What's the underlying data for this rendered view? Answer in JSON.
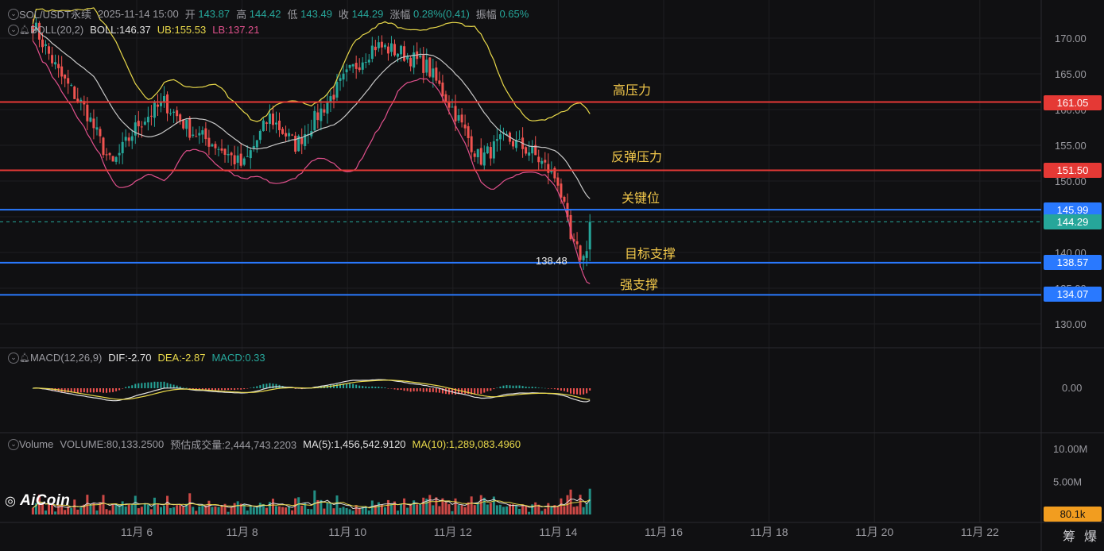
{
  "header": {
    "symbol": "SOL/USDT永续",
    "datetime": "2025-11-14 15:00",
    "open_label": "开",
    "open": "143.87",
    "high_label": "高",
    "high": "144.42",
    "low_label": "低",
    "low": "143.49",
    "close_label": "收",
    "close": "144.29",
    "change_label": "涨幅",
    "change": "0.28%(0.41)",
    "amp_label": "振幅",
    "amp": "0.65%"
  },
  "boll_legend": {
    "name": "BOLL(20,2)",
    "mid": "BOLL:146.37",
    "ub": "UB:155.53",
    "lb": "LB:137.21"
  },
  "macd_legend": {
    "name": "MACD(12,26,9)",
    "dif": "DIF:-2.70",
    "dea": "DEA:-2.87",
    "macd": "MACD:0.33"
  },
  "volume_legend": {
    "name": "Volume",
    "volume": "VOLUME:80,133.2500",
    "est": "预估成交量:2,444,743.2203",
    "ma5": "MA(5):1,456,542.9120",
    "ma10": "MA(10):1,289,083.4960"
  },
  "annotations": {
    "high_pressure": "高压力",
    "rebound_pressure": "反弹压力",
    "key_level": "关键位",
    "target_support": "目标支撑",
    "strong_support": "强支撑",
    "low_marker": "138.48"
  },
  "price_labels": {
    "r1": "161.05",
    "r2": "151.50",
    "key": "145.99",
    "current": "144.29",
    "s1": "138.57",
    "s2": "134.07",
    "volume_current": "80.1k"
  },
  "logo": "AiCoin",
  "corner_buttons": [
    "筹",
    "爆"
  ],
  "colors": {
    "up": "#26a69a",
    "down": "#ef5350",
    "resistance": "#e53935",
    "support": "#2979ff",
    "current_price": "#26a69a",
    "boll_mid": "#c8c8c8",
    "boll_ub": "#e8d84a",
    "boll_lb": "#e0508c",
    "dif": "#e0e0e0",
    "dea": "#e8d84a",
    "annotation": "#f0c64a",
    "volume_label": "#f29d1f"
  },
  "chart_data": [
    {
      "type": "line",
      "title": "SOL/USDT永续",
      "description": "Candlestick price chart with Bollinger Bands (20,2), hourly candles",
      "y_axis": {
        "ticks": [
          "130.00",
          "135.00",
          "140.00",
          "145.00",
          "150.00",
          "155.00",
          "160.00",
          "165.00",
          "170.00"
        ],
        "ylim": [
          127.4,
          174.0
        ]
      },
      "x_axis": {
        "ticks": [
          "11月 6",
          "11月 8",
          "11月 10",
          "11月 12",
          "11月 14",
          "11月 16",
          "11月 18",
          "11月 20",
          "11月 22"
        ]
      },
      "key_points": {
        "x": [
          4.0,
          4.5,
          5.0,
          5.5,
          6.0,
          6.5,
          7.0,
          7.5,
          8.0,
          8.5,
          9.0,
          9.5,
          10.0,
          10.5,
          11.0,
          11.5,
          12.0,
          12.5,
          13.0,
          13.5,
          14.0,
          14.25,
          14.5,
          14.6
        ],
        "close": [
          172,
          165,
          160,
          152,
          158,
          161,
          157,
          155,
          152,
          159,
          155,
          160,
          165,
          169,
          168,
          166,
          160,
          153,
          156,
          154,
          150,
          141,
          139,
          144.29
        ]
      },
      "horizontal_levels": [
        {
          "value": 161.05,
          "label": "高压力",
          "color": "#e53935"
        },
        {
          "value": 151.5,
          "label": "反弹压力",
          "color": "#e53935"
        },
        {
          "value": 145.99,
          "label": "关键位",
          "color": "#2979ff"
        },
        {
          "value": 138.57,
          "label": "目标支撑",
          "color": "#2979ff"
        },
        {
          "value": 134.07,
          "label": "强支撑",
          "color": "#2979ff"
        }
      ],
      "current_price": 144.29,
      "low_marker": 138.48
    },
    {
      "type": "bar",
      "title": "MACD(12,26,9)",
      "y_axis": {
        "ticks": [
          "0.00"
        ]
      },
      "dif": -2.7,
      "dea": -2.87,
      "macd": 0.33
    },
    {
      "type": "bar",
      "title": "Volume",
      "y_axis": {
        "ticks": [
          "5.00M",
          "10.00M"
        ],
        "ylim": [
          0,
          10.9
        ]
      },
      "volume": 80133.25,
      "ma5": 1456542.912,
      "ma10": 1289083.496
    }
  ]
}
